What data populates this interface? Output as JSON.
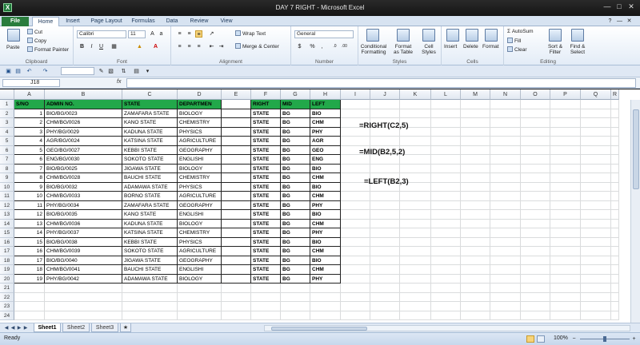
{
  "window": {
    "title": "DAY 7 RIGHT - Microsoft Excel",
    "app_icon": "X"
  },
  "tabs": [
    {
      "label": "File"
    },
    {
      "label": "Home"
    },
    {
      "label": "Insert"
    },
    {
      "label": "Page Layout"
    },
    {
      "label": "Formulas"
    },
    {
      "label": "Data"
    },
    {
      "label": "Review"
    },
    {
      "label": "View"
    }
  ],
  "ribbon": {
    "clipboard": {
      "paste": "Paste",
      "cut": "Cut",
      "copy": "Copy",
      "format_painter": "Format Painter",
      "label": "Clipboard"
    },
    "font": {
      "name": "Calibri",
      "size": "11",
      "label": "Font"
    },
    "alignment": {
      "wrap_text": "Wrap Text",
      "merge_center": "Merge & Center",
      "label": "Alignment"
    },
    "number": {
      "format": "General",
      "label": "Number"
    },
    "styles": {
      "conditional": "Conditional",
      "conditional2": "Formatting",
      "format_as": "Format",
      "format_as2": "as Table",
      "cell": "Cell",
      "cell2": "Styles",
      "label": "Styles"
    },
    "cells": {
      "insert": "Insert",
      "delete": "Delete",
      "format": "Format",
      "label": "Cells"
    },
    "editing": {
      "autosum": "AutoSum",
      "fill": "Fill",
      "clear": "Clear",
      "sort": "Sort &",
      "sort2": "Filter",
      "find": "Find &",
      "find2": "Select",
      "label": "Editing"
    }
  },
  "formula_bar": {
    "name_box": "J18",
    "fx": "fx",
    "value": ""
  },
  "columns": [
    "A",
    "B",
    "C",
    "D",
    "E",
    "F",
    "G",
    "H",
    "I",
    "J",
    "K",
    "L",
    "M",
    "N",
    "O",
    "P",
    "Q",
    "R"
  ],
  "row_numbers": [
    "1",
    "2",
    "3",
    "4",
    "5",
    "6",
    "7",
    "8",
    "9",
    "10",
    "11",
    "12",
    "13",
    "14",
    "15",
    "16",
    "17",
    "18",
    "19",
    "20",
    "21",
    "22",
    "23",
    "24"
  ],
  "table": {
    "headers": [
      "S/NO",
      "ADMIN NO.",
      "STATE",
      "DEPARTMEN",
      "",
      "RIGHT",
      "MID",
      "LEFT"
    ],
    "rows": [
      [
        "1",
        "BIO/BG/0023",
        "ZAMAFARA STATE",
        "BIOLOGY",
        "",
        "STATE",
        "BG",
        "BIO"
      ],
      [
        "2",
        "CHM/BG/0026",
        "KANO STATE",
        "CHEMISTRY",
        "",
        "STATE",
        "BG",
        "CHM"
      ],
      [
        "3",
        "PHY/BG/0029",
        "KADUNA STATE",
        "PHYSICS",
        "",
        "STATE",
        "BG",
        "PHY"
      ],
      [
        "4",
        "AGR/BG/0024",
        "KATSINA STATE",
        "AGRICULTURE",
        "",
        "STATE",
        "BG",
        "AGR"
      ],
      [
        "5",
        "GEO/BG/0027",
        "KEBBI STATE",
        "GEOGRAPHY",
        "",
        "STATE",
        "BG",
        "GEO"
      ],
      [
        "6",
        "ENG/BG/0030",
        "SOKOTO STATE",
        "ENGLISHI",
        "",
        "STATE",
        "BG",
        "ENG"
      ],
      [
        "7",
        "BIO/BG/0025",
        "JIGAWA STATE",
        "BIOLOGY",
        "",
        "STATE",
        "BG",
        "BIO"
      ],
      [
        "8",
        "CHM/BG/0028",
        "BAUCHI STATE",
        "CHEMISTRY",
        "",
        "STATE",
        "BG",
        "CHM"
      ],
      [
        "9",
        "BIO/BG/0032",
        "ADAMAWA STATE",
        "PHYSICS",
        "",
        "STATE",
        "BG",
        "BIO"
      ],
      [
        "10",
        "CHM/BG/0033",
        "BORNO STATE",
        "AGRICULTURE",
        "",
        "STATE",
        "BG",
        "CHM"
      ],
      [
        "11",
        "PHY/BG/0034",
        "ZAMAFARA STATE",
        "GEOGRAPHY",
        "",
        "STATE",
        "BG",
        "PHY"
      ],
      [
        "12",
        "BIO/BG/0035",
        "KANO STATE",
        "ENGLISHI",
        "",
        "STATE",
        "BG",
        "BIO"
      ],
      [
        "13",
        "CHM/BG/0036",
        "KADUNA STATE",
        "BIOLOGY",
        "",
        "STATE",
        "BG",
        "CHM"
      ],
      [
        "14",
        "PHY/BG/0037",
        "KATSINA STATE",
        "CHEMISTRY",
        "",
        "STATE",
        "BG",
        "PHY"
      ],
      [
        "15",
        "BIO/BG/0038",
        "KEBBI STATE",
        "PHYSICS",
        "",
        "STATE",
        "BG",
        "BIO"
      ],
      [
        "16",
        "CHM/BG/0039",
        "SOKOTO STATE",
        "AGRICULTURE",
        "",
        "STATE",
        "BG",
        "CHM"
      ],
      [
        "17",
        "BIO/BG/0040",
        "JIGAWA STATE",
        "GEOGRAPHY",
        "",
        "STATE",
        "BG",
        "BIO"
      ],
      [
        "18",
        "CHM/BG/0041",
        "BAUCHI STATE",
        "ENGLISHI",
        "",
        "STATE",
        "BG",
        "CHM"
      ],
      [
        "19",
        "PHY/BG/0042",
        "ADAMAWA STATE",
        "BIOLOGY",
        "",
        "STATE",
        "BG",
        "PHY"
      ]
    ]
  },
  "notes": {
    "right": "=RIGHT(C2,5)",
    "mid": "=MID(B2,5,2)",
    "left": "=LEFT(B2,3)"
  },
  "sheets": [
    {
      "label": "Sheet1"
    },
    {
      "label": "Sheet2"
    },
    {
      "label": "Sheet3"
    }
  ],
  "status": {
    "text": "Ready",
    "zoom": "100%"
  },
  "colors": {
    "header_fill": "#22a84a",
    "file_tab": "#2a7d3d"
  }
}
